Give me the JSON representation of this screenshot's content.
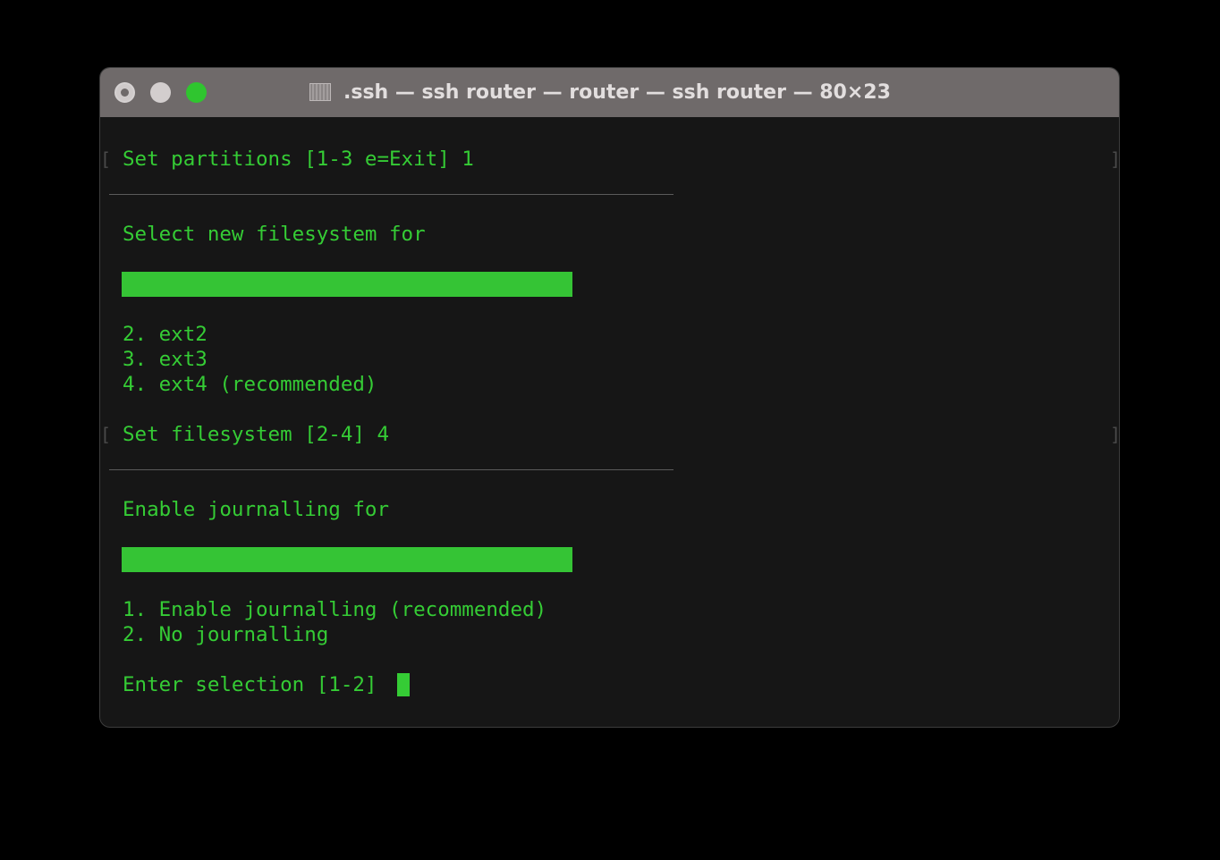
{
  "window": {
    "title": ".ssh — ssh router — router — ssh router — 80×23",
    "title_icon": "terminal-icon"
  },
  "colors": {
    "terminal_bg": "#161616",
    "text": "#35cc35",
    "titlebar": "#6f6a6a",
    "close": "#cfcaca",
    "minimize": "#d3cece",
    "zoom": "#2fc52f"
  },
  "terminal": {
    "prompt_partitions": "Set partitions [1-3 e=Exit] 1",
    "heading_filesystem": "Select new filesystem for",
    "fs_options": [
      "2. ext2",
      "3. ext3",
      "4. ext4 (recommended)"
    ],
    "prompt_filesystem": "Set filesystem [2-4] 4",
    "heading_journal": "Enable journalling for",
    "journal_options": [
      "1. Enable journalling (recommended)",
      "2. No journalling"
    ],
    "prompt_selection": "Enter selection [1-2] "
  }
}
